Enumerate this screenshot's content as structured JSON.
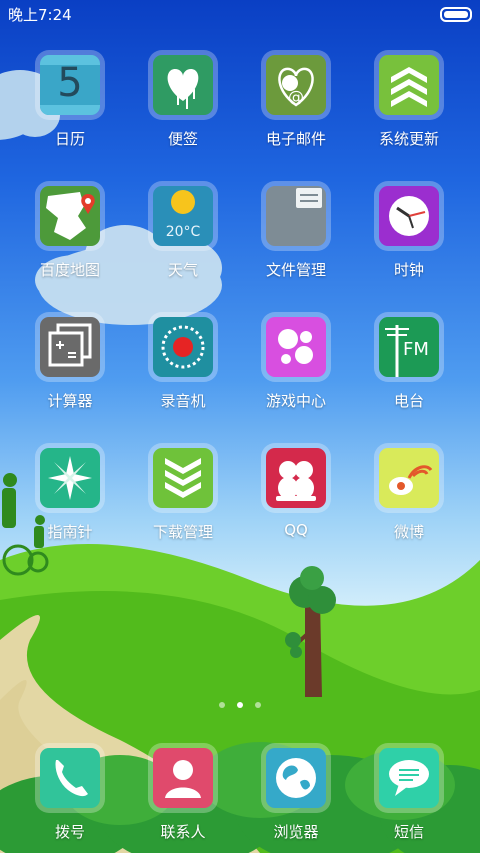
{
  "status_bar": {
    "time": "晚上7:24",
    "battery_icon": "battery-icon"
  },
  "apps": [
    {
      "label": "日历",
      "icon": "calendar-icon",
      "color": "#3aa6c8",
      "day": "5"
    },
    {
      "label": "便签",
      "icon": "notes-heart-icon",
      "color": "#2f9b63"
    },
    {
      "label": "电子邮件",
      "icon": "email-icon",
      "color": "#6c9a3c"
    },
    {
      "label": "系统更新",
      "icon": "system-update-icon",
      "color": "#78c13c"
    },
    {
      "label": "百度地图",
      "icon": "map-icon",
      "color": "#4d9a3a"
    },
    {
      "label": "天气",
      "icon": "weather-sun-icon",
      "color": "#2a8fb8",
      "temperature": "20°C"
    },
    {
      "label": "文件管理",
      "icon": "folder-icon",
      "color": "#7e8c95"
    },
    {
      "label": "时钟",
      "icon": "clock-icon",
      "color": "#9b2ecf"
    },
    {
      "label": "计算器",
      "icon": "calculator-icon",
      "color": "#6a6a6a"
    },
    {
      "label": "录音机",
      "icon": "recorder-icon",
      "color": "#1f8fa0"
    },
    {
      "label": "游戏中心",
      "icon": "game-center-icon",
      "color": "#d84fe0"
    },
    {
      "label": "电台",
      "icon": "radio-fm-icon",
      "color": "#1c9a55",
      "fm": "FM"
    },
    {
      "label": "指南针",
      "icon": "compass-icon",
      "color": "#25b589"
    },
    {
      "label": "下载管理",
      "icon": "download-icon",
      "color": "#6fc23a"
    },
    {
      "label": "QQ",
      "icon": "qq-icon",
      "color": "#d4294b"
    },
    {
      "label": "微博",
      "icon": "weibo-icon",
      "color": "#d9ea5a"
    }
  ],
  "page_indicator": {
    "pages": 3,
    "current": 2
  },
  "dock": [
    {
      "label": "拨号",
      "icon": "phone-icon",
      "color": "#31c49a"
    },
    {
      "label": "联系人",
      "icon": "contacts-icon",
      "color": "#e04a6c"
    },
    {
      "label": "浏览器",
      "icon": "browser-globe-icon",
      "color": "#35a9c9"
    },
    {
      "label": "短信",
      "icon": "message-icon",
      "color": "#2fd0a8"
    }
  ]
}
